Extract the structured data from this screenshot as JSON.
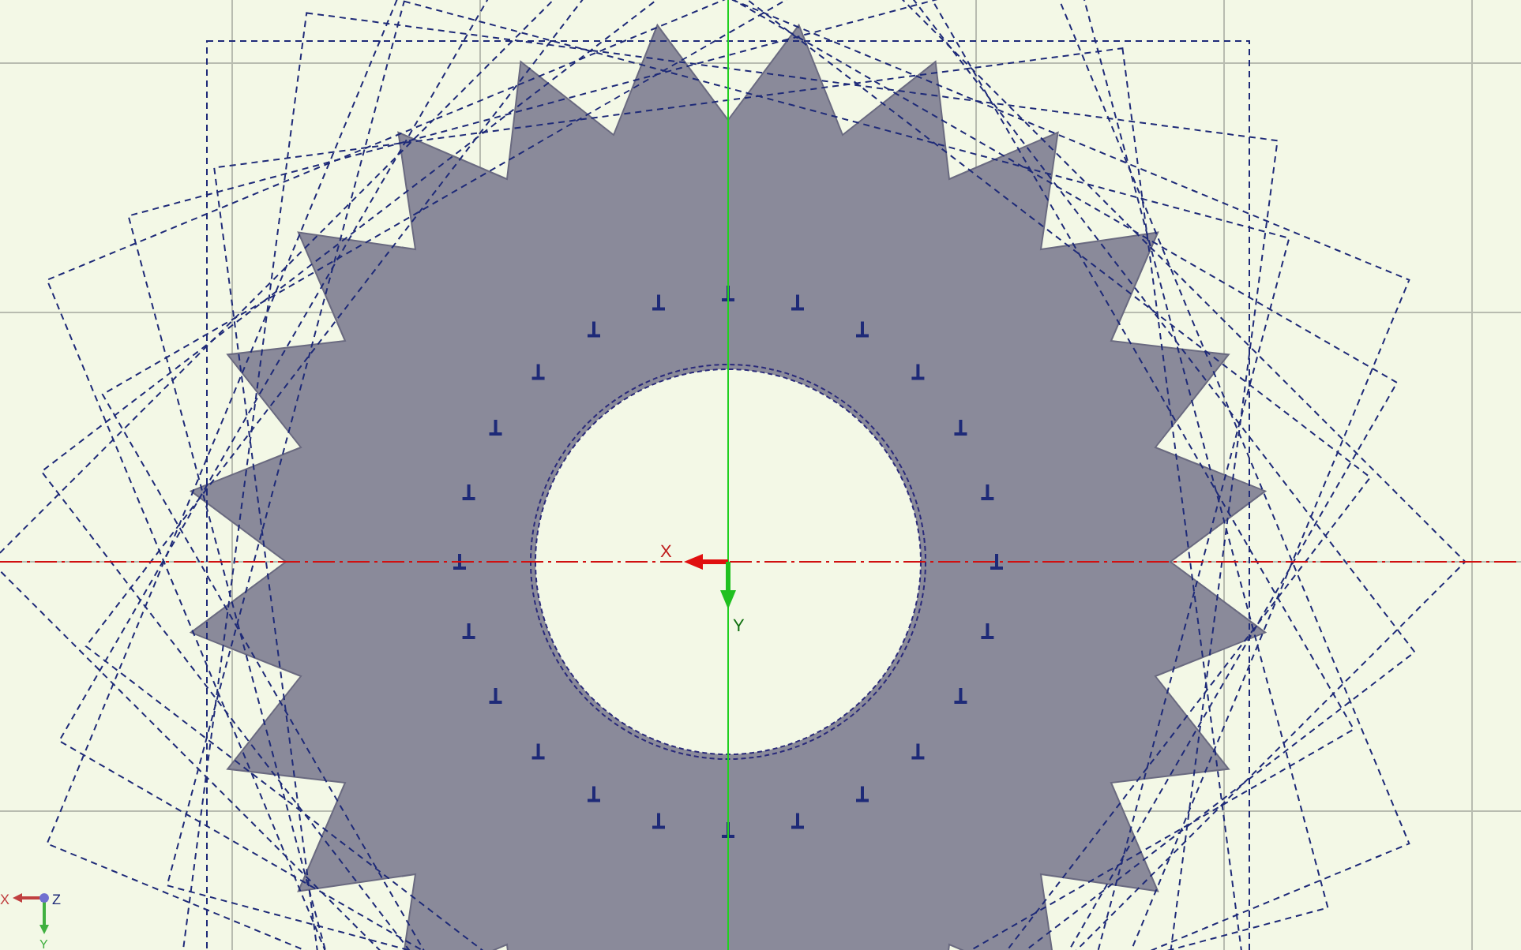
{
  "viewport": {
    "axis_labels": {
      "x": "X",
      "y": "Y"
    },
    "triad": {
      "x": "X",
      "y": "Y",
      "z": "Z"
    }
  }
}
